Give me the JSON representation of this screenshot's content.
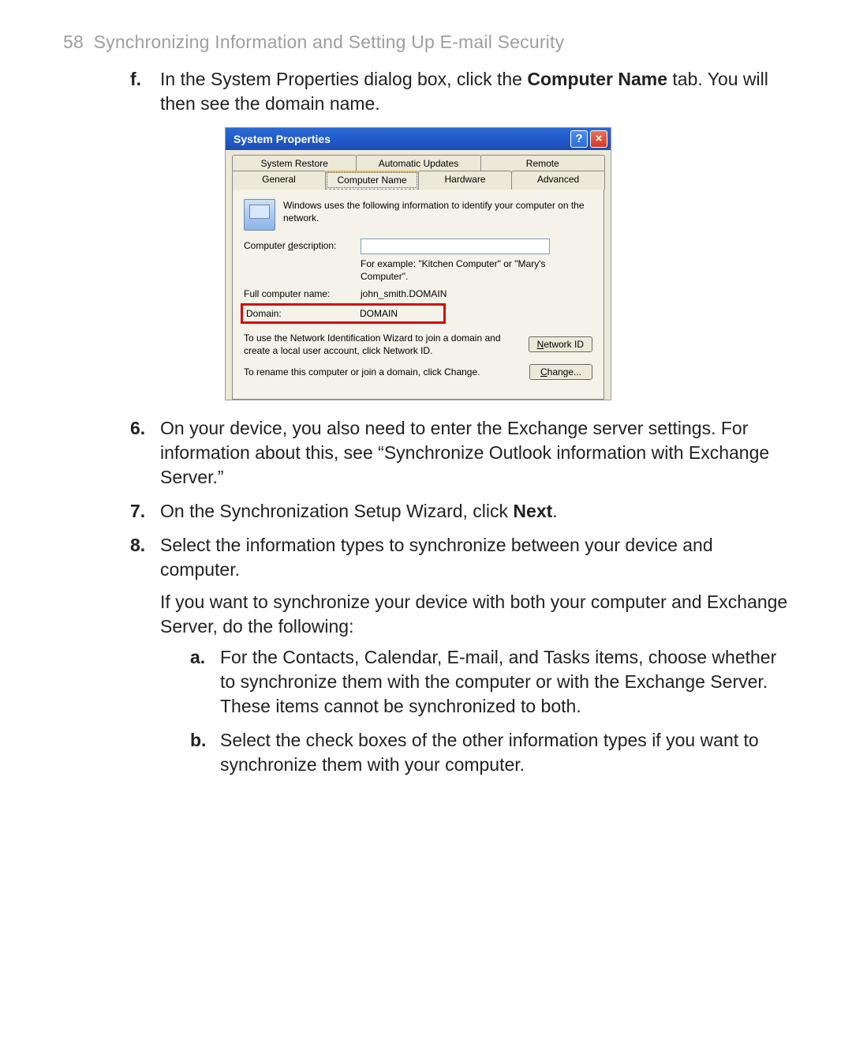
{
  "header": {
    "page_number": "58",
    "title": "Synchronizing Information and Setting Up E-mail Security"
  },
  "steps": {
    "f": {
      "marker": "f.",
      "text_before": "In the System Properties dialog box, click the ",
      "bold": "Computer Name",
      "text_after": " tab. You will then see the domain name."
    },
    "s6": {
      "marker": "6.",
      "text": "On your device, you also need to enter the Exchange server settings. For information about this, see “Synchronize Outlook information with Exchange Server.”"
    },
    "s7": {
      "marker": "7.",
      "text_before": "On the Synchronization Setup Wizard, click ",
      "bold": "Next",
      "text_after": "."
    },
    "s8": {
      "marker": "8.",
      "text": "Select the information types to synchronize between your device and computer.",
      "extra": "If you want to synchronize your device with both your computer and Exchange Server, do the following:"
    },
    "a": {
      "marker": "a.",
      "text": "For the Contacts, Calendar, E-mail, and Tasks items, choose whether to synchronize them with the computer or with the Exchange Server. These items cannot be synchronized to both."
    },
    "b": {
      "marker": "b.",
      "text": "Select the check boxes of the other information types if you want to synchronize them with your computer."
    }
  },
  "dialog": {
    "title": "System Properties",
    "tabs_top": [
      "System Restore",
      "Automatic Updates",
      "Remote"
    ],
    "tabs_bottom": [
      "General",
      "Computer Name",
      "Hardware",
      "Advanced"
    ],
    "intro": "Windows uses the following information to identify your computer on the network.",
    "desc_label": "Computer description:",
    "desc_hint": "For example: \"Kitchen Computer\" or \"Mary's Computer\".",
    "fullname_label": "Full computer name:",
    "fullname_value": "john_smith.DOMAIN",
    "domain_label": "Domain:",
    "domain_value": "DOMAIN",
    "netid_text": "To use the Network Identification Wizard to join a domain and create a local user account, click Network ID.",
    "netid_btn": "Network ID",
    "change_text": "To rename this computer or join a domain, click Change.",
    "change_btn": "Change..."
  }
}
